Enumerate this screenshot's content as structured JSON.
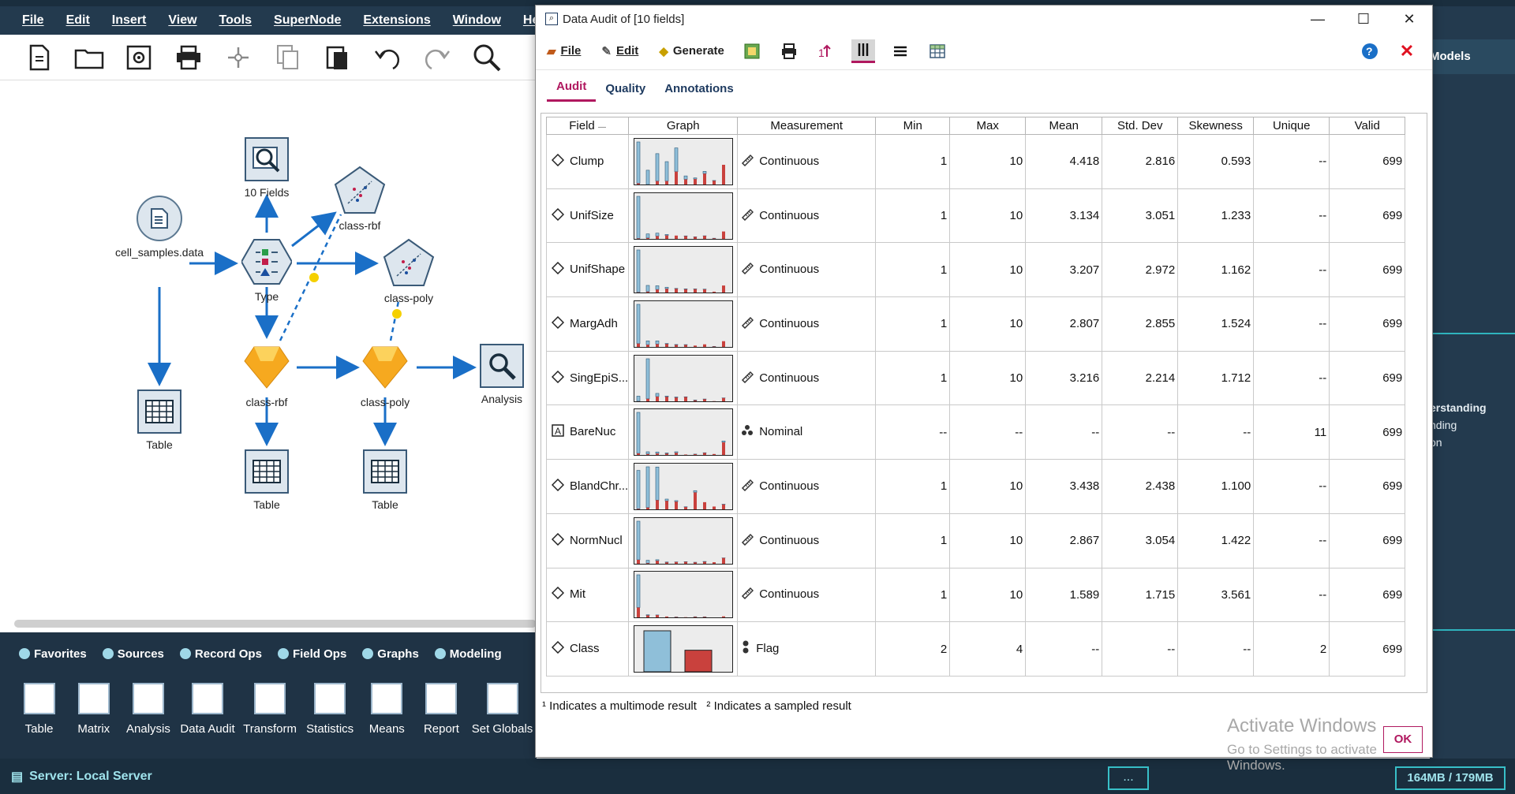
{
  "menubar": {
    "items": [
      "File",
      "Edit",
      "Insert",
      "View",
      "Tools",
      "SuperNode",
      "Extensions",
      "Window",
      "He"
    ]
  },
  "canvas": {
    "nodes": [
      {
        "name": "cell_samples.data",
        "icon": "source-file-icon"
      },
      {
        "name": "Type",
        "icon": "type-node-icon"
      },
      {
        "name": "10 Fields",
        "icon": "data-audit-icon"
      },
      {
        "name": "class-rbf",
        "icon": "svm-model-icon",
        "kind": "model"
      },
      {
        "name": "class-poly",
        "icon": "svm-model-icon",
        "kind": "model"
      },
      {
        "name": "class-rbf",
        "icon": "generated-model-icon",
        "kind": "nugget"
      },
      {
        "name": "class-poly",
        "icon": "generated-model-icon",
        "kind": "nugget"
      },
      {
        "name": "Analysis",
        "icon": "analysis-icon"
      },
      {
        "name": "Table",
        "icon": "table-icon"
      },
      {
        "name": "Table",
        "icon": "table-icon"
      },
      {
        "name": "Table",
        "icon": "table-icon"
      }
    ]
  },
  "palette": {
    "tabs": [
      "Favorites",
      "Sources",
      "Record Ops",
      "Field Ops",
      "Graphs",
      "Modeling"
    ],
    "nodes": [
      "Table",
      "Matrix",
      "Analysis",
      "Data Audit",
      "Transform",
      "Statistics",
      "Means",
      "Report",
      "Set Globals"
    ]
  },
  "status": {
    "server": "Server: Local Server",
    "dots": "...",
    "memory": "164MB / 179MB"
  },
  "right_panel": {
    "models_tab": "Models",
    "text_lines": [
      "erstanding",
      "nding",
      "on"
    ]
  },
  "dialog": {
    "title": "Data Audit of [10 fields]",
    "menus": [
      "File",
      "Edit",
      "Generate"
    ],
    "tabs": [
      "Audit",
      "Quality",
      "Annotations"
    ],
    "active_tab": "Audit",
    "columns": [
      "Field",
      "Graph",
      "Measurement",
      "Min",
      "Max",
      "Mean",
      "Std. Dev",
      "Skewness",
      "Unique",
      "Valid"
    ],
    "rows": [
      {
        "field": "Clump",
        "type_icon": "continuous-diamond-icon",
        "measurement": "Continuous",
        "min": "1",
        "max": "10",
        "mean": "4.418",
        "std": "2.816",
        "skew": "0.593",
        "unique": "--",
        "valid": "699",
        "hist_blue": [
          0.34,
          0.18,
          0.68,
          0.75,
          0.0,
          0.18,
          0.0,
          0.0,
          0.0,
          0.0
        ],
        "hist_red": [
          0.0,
          0.0,
          0.0,
          0.0,
          0.0,
          0.0,
          0.0,
          0.0,
          0.0,
          0.0
        ],
        "hist": [
          [
            145,
            4
          ],
          [
            50,
            0
          ],
          [
            96,
            12
          ],
          [
            68,
            12
          ],
          [
            83,
            45
          ],
          [
            12,
            18
          ],
          [
            4,
            19
          ],
          [
            8,
            38
          ],
          [
            1,
            13
          ],
          [
            0,
            69
          ]
        ]
      },
      {
        "field": "UnifSize",
        "type_icon": "continuous-diamond-icon",
        "measurement": "Continuous",
        "min": "1",
        "max": "10",
        "mean": "3.134",
        "std": "3.051",
        "skew": "1.233",
        "unique": "--",
        "valid": "699",
        "hist": [
          [
            380,
            4
          ],
          [
            37,
            8
          ],
          [
            27,
            25
          ],
          [
            9,
            31
          ],
          [
            0,
            30
          ],
          [
            2,
            25
          ],
          [
            1,
            18
          ],
          [
            1,
            27
          ],
          [
            1,
            5
          ],
          [
            0,
            67
          ]
        ]
      },
      {
        "field": "UnifShape",
        "type_icon": "continuous-diamond-icon",
        "measurement": "Continuous",
        "min": "1",
        "max": "10",
        "mean": "3.207",
        "std": "2.972",
        "skew": "1.162",
        "unique": "--",
        "valid": "699",
        "hist": [
          [
            351,
            2
          ],
          [
            52,
            7
          ],
          [
            31,
            25
          ],
          [
            13,
            31
          ],
          [
            3,
            31
          ],
          [
            3,
            27
          ],
          [
            2,
            28
          ],
          [
            2,
            26
          ],
          [
            0,
            7
          ],
          [
            0,
            58
          ]
        ]
      },
      {
        "field": "MargAdh",
        "type_icon": "continuous-diamond-icon",
        "measurement": "Continuous",
        "min": "1",
        "max": "10",
        "mean": "2.807",
        "std": "2.855",
        "skew": "1.524",
        "unique": "--",
        "valid": "699",
        "hist": [
          [
            375,
            32
          ],
          [
            37,
            21
          ],
          [
            31,
            27
          ],
          [
            5,
            28
          ],
          [
            4,
            19
          ],
          [
            3,
            19
          ],
          [
            0,
            13
          ],
          [
            0,
            25
          ],
          [
            1,
            4
          ],
          [
            0,
            55
          ]
        ]
      },
      {
        "field": "SingEpiS...",
        "type_icon": "continuous-diamond-icon",
        "measurement": "Continuous",
        "min": "1",
        "max": "10",
        "mean": "3.216",
        "std": "2.214",
        "skew": "1.712",
        "unique": "--",
        "valid": "699",
        "hist": [
          [
            46,
            1
          ],
          [
            363,
            23
          ],
          [
            29,
            43
          ],
          [
            7,
            41
          ],
          [
            5,
            34
          ],
          [
            2,
            39
          ],
          [
            3,
            9
          ],
          [
            2,
            19
          ],
          [
            0,
            2
          ],
          [
            1,
            30
          ]
        ]
      },
      {
        "field": "BareNuc",
        "type_icon": "nominal-a-icon",
        "measurement": "Nominal",
        "min": "--",
        "max": "--",
        "mean": "--",
        "std": "--",
        "skew": "--",
        "unique": "11",
        "valid": "699",
        "hist": [
          [
            387,
            15
          ],
          [
            21,
            9
          ],
          [
            14,
            14
          ],
          [
            6,
            13
          ],
          [
            10,
            20
          ],
          [
            0,
            4
          ],
          [
            1,
            7
          ],
          [
            2,
            19
          ],
          [
            0,
            9
          ],
          [
            13,
            119
          ]
        ]
      },
      {
        "field": "BlandChr...",
        "type_icon": "continuous-diamond-icon",
        "measurement": "Continuous",
        "min": "1",
        "max": "10",
        "mean": "3.438",
        "std": "2.438",
        "skew": "1.100",
        "unique": "--",
        "valid": "699",
        "hist": [
          [
            150,
            2
          ],
          [
            159,
            7
          ],
          [
            129,
            36
          ],
          [
            7,
            33
          ],
          [
            4,
            30
          ],
          [
            1,
            9
          ],
          [
            7,
            66
          ],
          [
            0,
            28
          ],
          [
            0,
            11
          ],
          [
            1,
            19
          ]
        ]
      },
      {
        "field": "NormNucl",
        "type_icon": "continuous-diamond-icon",
        "measurement": "Continuous",
        "min": "1",
        "max": "10",
        "mean": "2.867",
        "std": "3.054",
        "skew": "1.422",
        "unique": "--",
        "valid": "699",
        "hist": [
          [
            402,
            41
          ],
          [
            30,
            6
          ],
          [
            11,
            31
          ],
          [
            4,
            14
          ],
          [
            1,
            18
          ],
          [
            2,
            20
          ],
          [
            2,
            14
          ],
          [
            4,
            20
          ],
          [
            0,
            16
          ],
          [
            1,
            60
          ]
        ]
      },
      {
        "field": "Mit",
        "type_icon": "continuous-diamond-icon",
        "measurement": "Continuous",
        "min": "1",
        "max": "10",
        "mean": "1.589",
        "std": "1.715",
        "skew": "3.561",
        "unique": "--",
        "valid": "699",
        "hist": [
          [
            445,
            134
          ],
          [
            8,
            27
          ],
          [
            2,
            31
          ],
          [
            0,
            12
          ],
          [
            1,
            5
          ],
          [
            0,
            3
          ],
          [
            1,
            8
          ],
          [
            1,
            7
          ],
          [
            0,
            0
          ],
          [
            0,
            14
          ]
        ]
      },
      {
        "field": "Class",
        "type_icon": "flag-icon",
        "measurement": "Flag",
        "min": "2",
        "max": "4",
        "mean": "--",
        "std": "--",
        "skew": "--",
        "unique": "2",
        "valid": "699",
        "flag": [
          458,
          241
        ]
      }
    ],
    "footnote": "¹ Indicates a multimode result   ² Indicates a sampled result",
    "ok_label": "OK",
    "watermark_title": "Activate Windows",
    "watermark_sub": "Go to Settings to activate Windows."
  },
  "colors": {
    "bar_blue": "#8fbfd9",
    "bar_red": "#c9413d",
    "accent": "#b0185f",
    "node_blue": "#1a6fc7"
  }
}
